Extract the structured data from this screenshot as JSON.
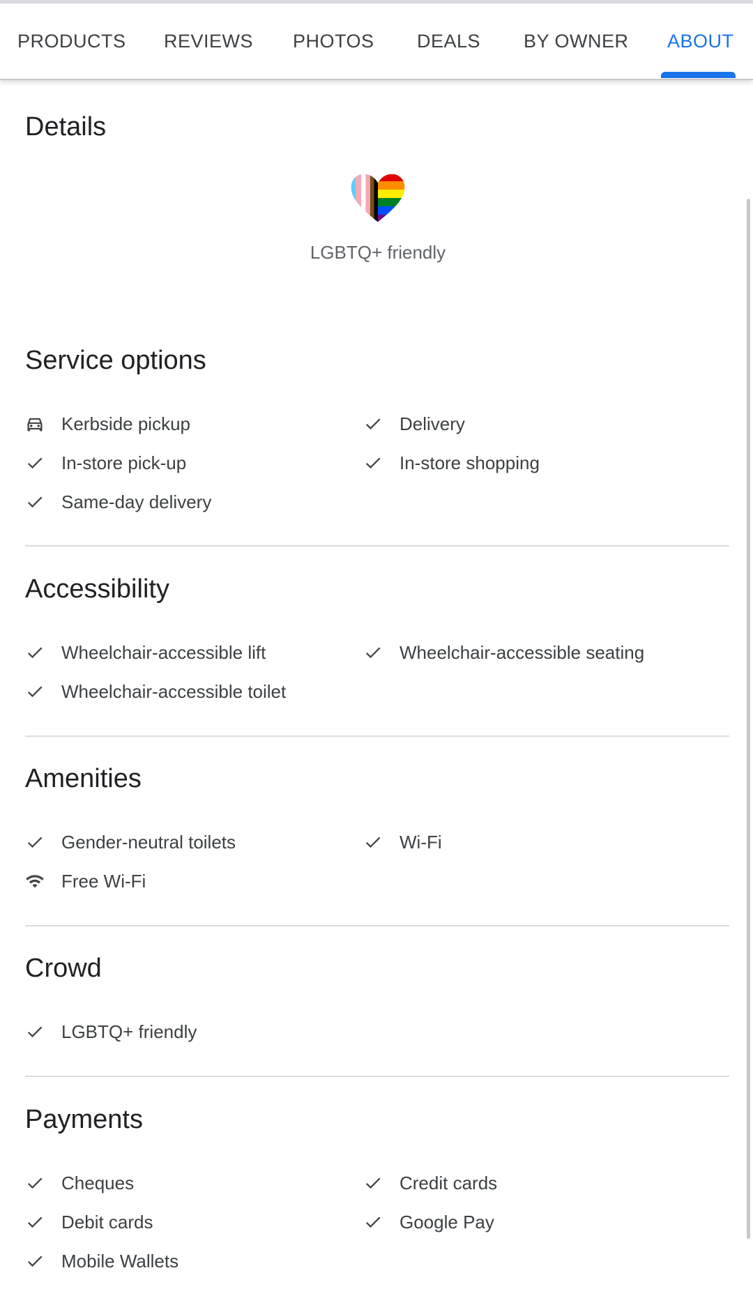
{
  "tabs": [
    {
      "label": "PRODUCTS"
    },
    {
      "label": "REVIEWS"
    },
    {
      "label": "PHOTOS"
    },
    {
      "label": "DEALS"
    },
    {
      "label": "BY OWNER"
    },
    {
      "label": "ABOUT",
      "active": true
    }
  ],
  "accent_color": "#1a73e8",
  "details": {
    "title": "Details",
    "badge_icon": "pride-heart-icon",
    "badge_label": "LGBTQ+ friendly"
  },
  "sections": [
    {
      "title": "Service options",
      "items": [
        {
          "label": "Kerbside pickup",
          "icon": "car-icon"
        },
        {
          "label": "Delivery",
          "icon": "check-icon"
        },
        {
          "label": "In-store pick-up",
          "icon": "check-icon"
        },
        {
          "label": "In-store shopping",
          "icon": "check-icon"
        },
        {
          "label": "Same-day delivery",
          "icon": "check-icon"
        }
      ]
    },
    {
      "title": "Accessibility",
      "items": [
        {
          "label": "Wheelchair-accessible lift",
          "icon": "check-icon"
        },
        {
          "label": "Wheelchair-accessible seating",
          "icon": "check-icon"
        },
        {
          "label": "Wheelchair-accessible toilet",
          "icon": "check-icon"
        }
      ]
    },
    {
      "title": "Amenities",
      "items": [
        {
          "label": "Gender-neutral toilets",
          "icon": "check-icon"
        },
        {
          "label": "Wi-Fi",
          "icon": "check-icon"
        },
        {
          "label": "Free Wi-Fi",
          "icon": "wifi-icon"
        }
      ]
    },
    {
      "title": "Crowd",
      "items": [
        {
          "label": "LGBTQ+ friendly",
          "icon": "check-icon"
        }
      ]
    },
    {
      "title": "Payments",
      "items": [
        {
          "label": "Cheques",
          "icon": "check-icon"
        },
        {
          "label": "Credit cards",
          "icon": "check-icon"
        },
        {
          "label": "Debit cards",
          "icon": "check-icon"
        },
        {
          "label": "Google Pay",
          "icon": "check-icon"
        },
        {
          "label": "Mobile Wallets",
          "icon": "check-icon"
        }
      ]
    }
  ]
}
